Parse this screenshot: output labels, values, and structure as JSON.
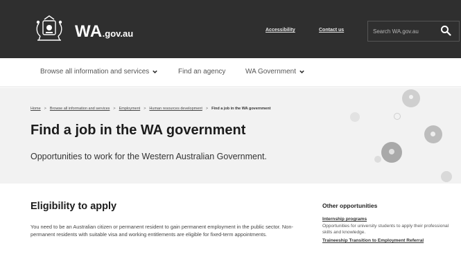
{
  "header": {
    "logo_main": "WA",
    "logo_suffix": ".gov.au",
    "links": [
      "Accessibility",
      "Contact us"
    ],
    "search_placeholder": "Search WA.gov.au",
    "bg_color": "#2f2f2f"
  },
  "nav": {
    "items": [
      {
        "label": "Browse all information and services",
        "dropdown": true
      },
      {
        "label": "Find an agency",
        "dropdown": false
      },
      {
        "label": "WA Government",
        "dropdown": true
      }
    ]
  },
  "breadcrumb": {
    "items": [
      "Home",
      "Browse all information and services",
      "Employment",
      "Human resources development"
    ],
    "current": "Find a job in the WA government"
  },
  "hero": {
    "title": "Find a job in the WA government",
    "subtitle": "Opportunities to work for the Western Australian Government."
  },
  "main": {
    "heading": "Eligibility to apply",
    "paragraph": "You need to be an Australian citizen or permanent resident to gain permanent employment in the public sector. Non-permanent residents with suitable visa and working entitlements are eligible for fixed-term appointments."
  },
  "sidebar": {
    "heading": "Other opportunities",
    "items": [
      {
        "title": "Internship programs",
        "desc": "Opportunities for university students to apply their professional skills and knowledge."
      },
      {
        "title": "Traineeship Transition to Employment Referral",
        "desc": ""
      }
    ]
  }
}
